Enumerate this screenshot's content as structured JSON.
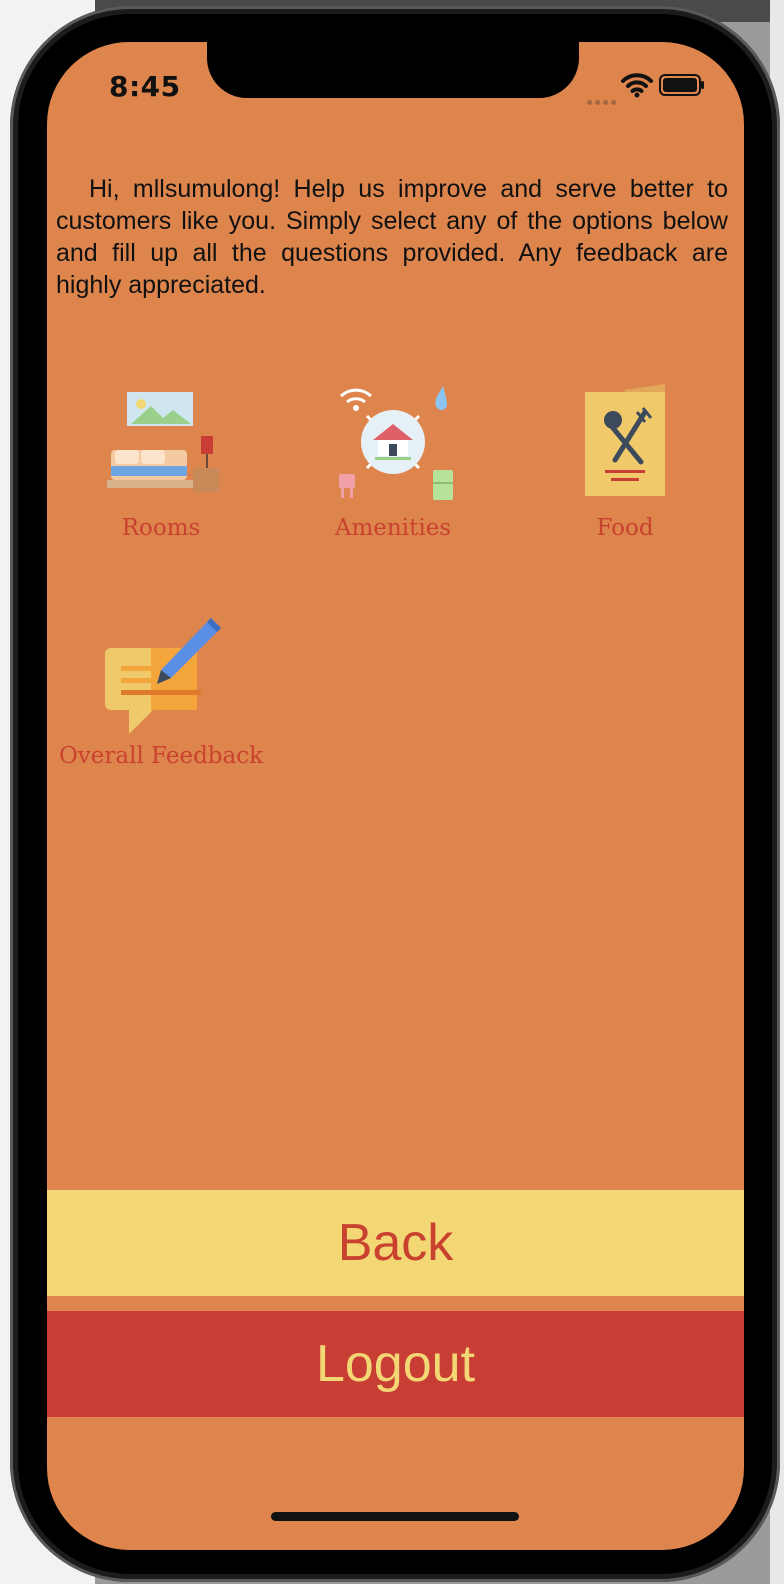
{
  "status_bar": {
    "time": "8:45"
  },
  "intro_text": "Hi, mllsumulong! Help us improve and serve better to customers like you. Simply select any of the options below and fill up all the questions provided. Any feedback are highly appreciated.",
  "options": [
    {
      "label": "Rooms",
      "icon": "bedroom-icon"
    },
    {
      "label": "Amenities",
      "icon": "smart-home-icon"
    },
    {
      "label": "Food",
      "icon": "menu-book-icon"
    },
    {
      "label": "Overall Feedback",
      "icon": "feedback-pencil-icon"
    }
  ],
  "buttons": {
    "back_label": "Back",
    "logout_label": "Logout"
  },
  "colors": {
    "screen_background": "#de854d",
    "label": "#c9412f",
    "back_button": "#f3d775",
    "logout_button": "#c83d34"
  }
}
